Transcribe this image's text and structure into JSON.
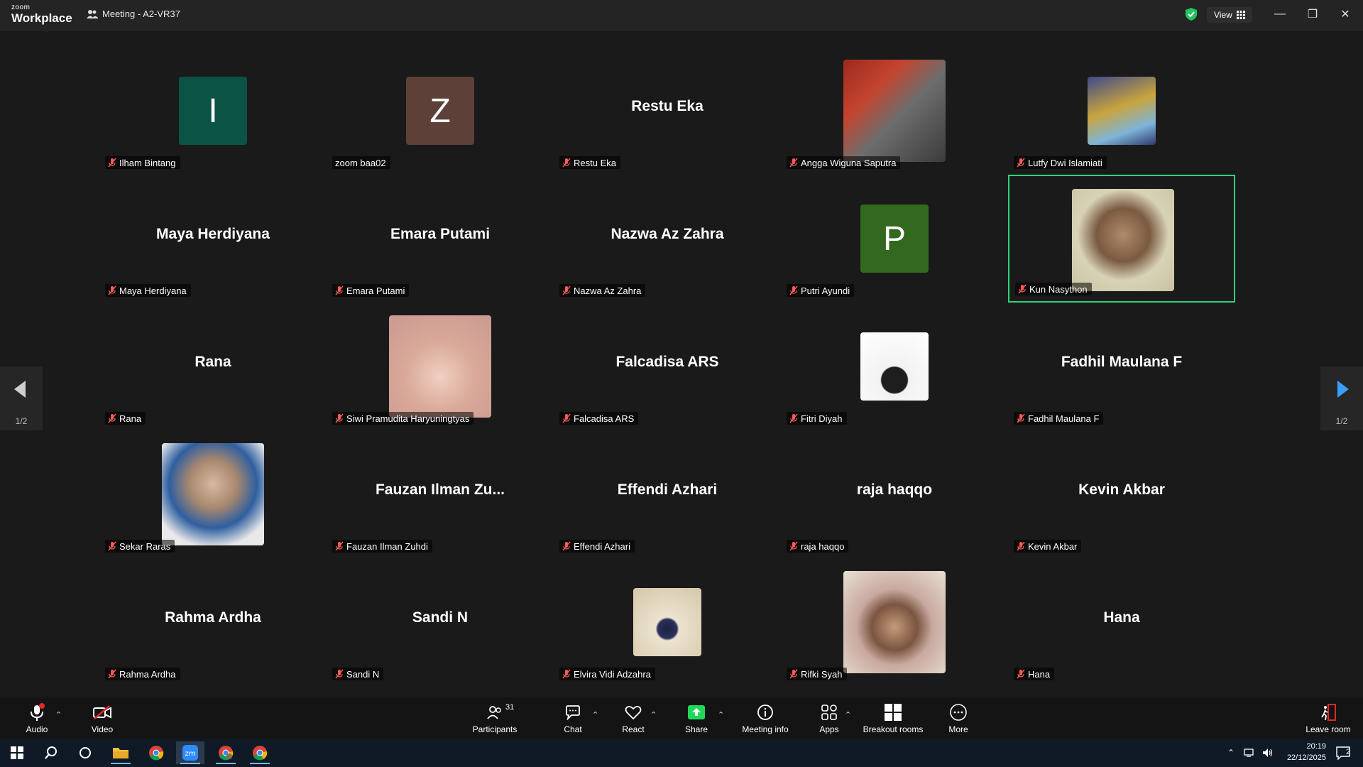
{
  "app": {
    "logo_top": "zoom",
    "logo_bottom": "Workplace",
    "meeting_title": "Meeting - A2-VR37",
    "view_label": "View"
  },
  "participants": [
    {
      "name": "Ilham Bintang",
      "display": "letter",
      "letter": "I",
      "color": "#0b5345"
    },
    {
      "name": "zoom baa02",
      "display": "letter",
      "letter": "Z",
      "color": "#5d4037",
      "mic_visible": false
    },
    {
      "name": "Restu Eka",
      "display": "name"
    },
    {
      "name": "Angga Wiguna Saputra",
      "display": "photo"
    },
    {
      "name": "Lutfy Dwi Islamiati",
      "display": "photo"
    },
    {
      "name": "Maya Herdiyana",
      "display": "name"
    },
    {
      "name": "Emara Putami",
      "display": "name"
    },
    {
      "name": "Nazwa Az Zahra",
      "display": "name"
    },
    {
      "name": "Putri Ayundi",
      "display": "letter",
      "letter": "P",
      "color": "#33691e"
    },
    {
      "name": "Kun Nasython",
      "display": "photo",
      "active": true
    },
    {
      "name": "Rana",
      "display": "name"
    },
    {
      "name": "Siwi Pramudita Haryuningtyas",
      "display": "photo"
    },
    {
      "name": "Falcadisa ARS",
      "display": "name"
    },
    {
      "name": "Fitri Diyah",
      "display": "photo"
    },
    {
      "name": "Fadhil Maulana F",
      "display": "name"
    },
    {
      "name": "Sekar Raras",
      "display": "photo"
    },
    {
      "name": "Fauzan Ilman Zuhdi",
      "display": "name",
      "big_label": "Fauzan  Ilman  Zu..."
    },
    {
      "name": "Effendi Azhari",
      "display": "name"
    },
    {
      "name": "raja haqqo",
      "display": "name"
    },
    {
      "name": "Kevin Akbar",
      "display": "name"
    },
    {
      "name": "Rahma Ardha",
      "display": "name"
    },
    {
      "name": "Sandi N",
      "display": "name"
    },
    {
      "name": "Elvira Vidi Adzahra",
      "display": "photo"
    },
    {
      "name": "Rifki Syah",
      "display": "photo"
    },
    {
      "name": "Hana",
      "display": "name"
    }
  ],
  "pager": {
    "left_label": "1/2",
    "right_label": "1/2"
  },
  "toolbar": {
    "audio": "Audio",
    "video": "Video",
    "participants": "Participants",
    "participants_count": "31",
    "chat": "Chat",
    "react": "React",
    "share": "Share",
    "meeting_info": "Meeting info",
    "apps": "Apps",
    "breakout": "Breakout rooms",
    "more": "More",
    "leave": "Leave room"
  },
  "taskbar": {
    "time": "20:19",
    "date": "22/12/2025",
    "notif_count": "2"
  },
  "colors": {
    "active_border": "#2ed37a",
    "share_green": "#1fd85a",
    "shield_green": "#22c55e"
  }
}
